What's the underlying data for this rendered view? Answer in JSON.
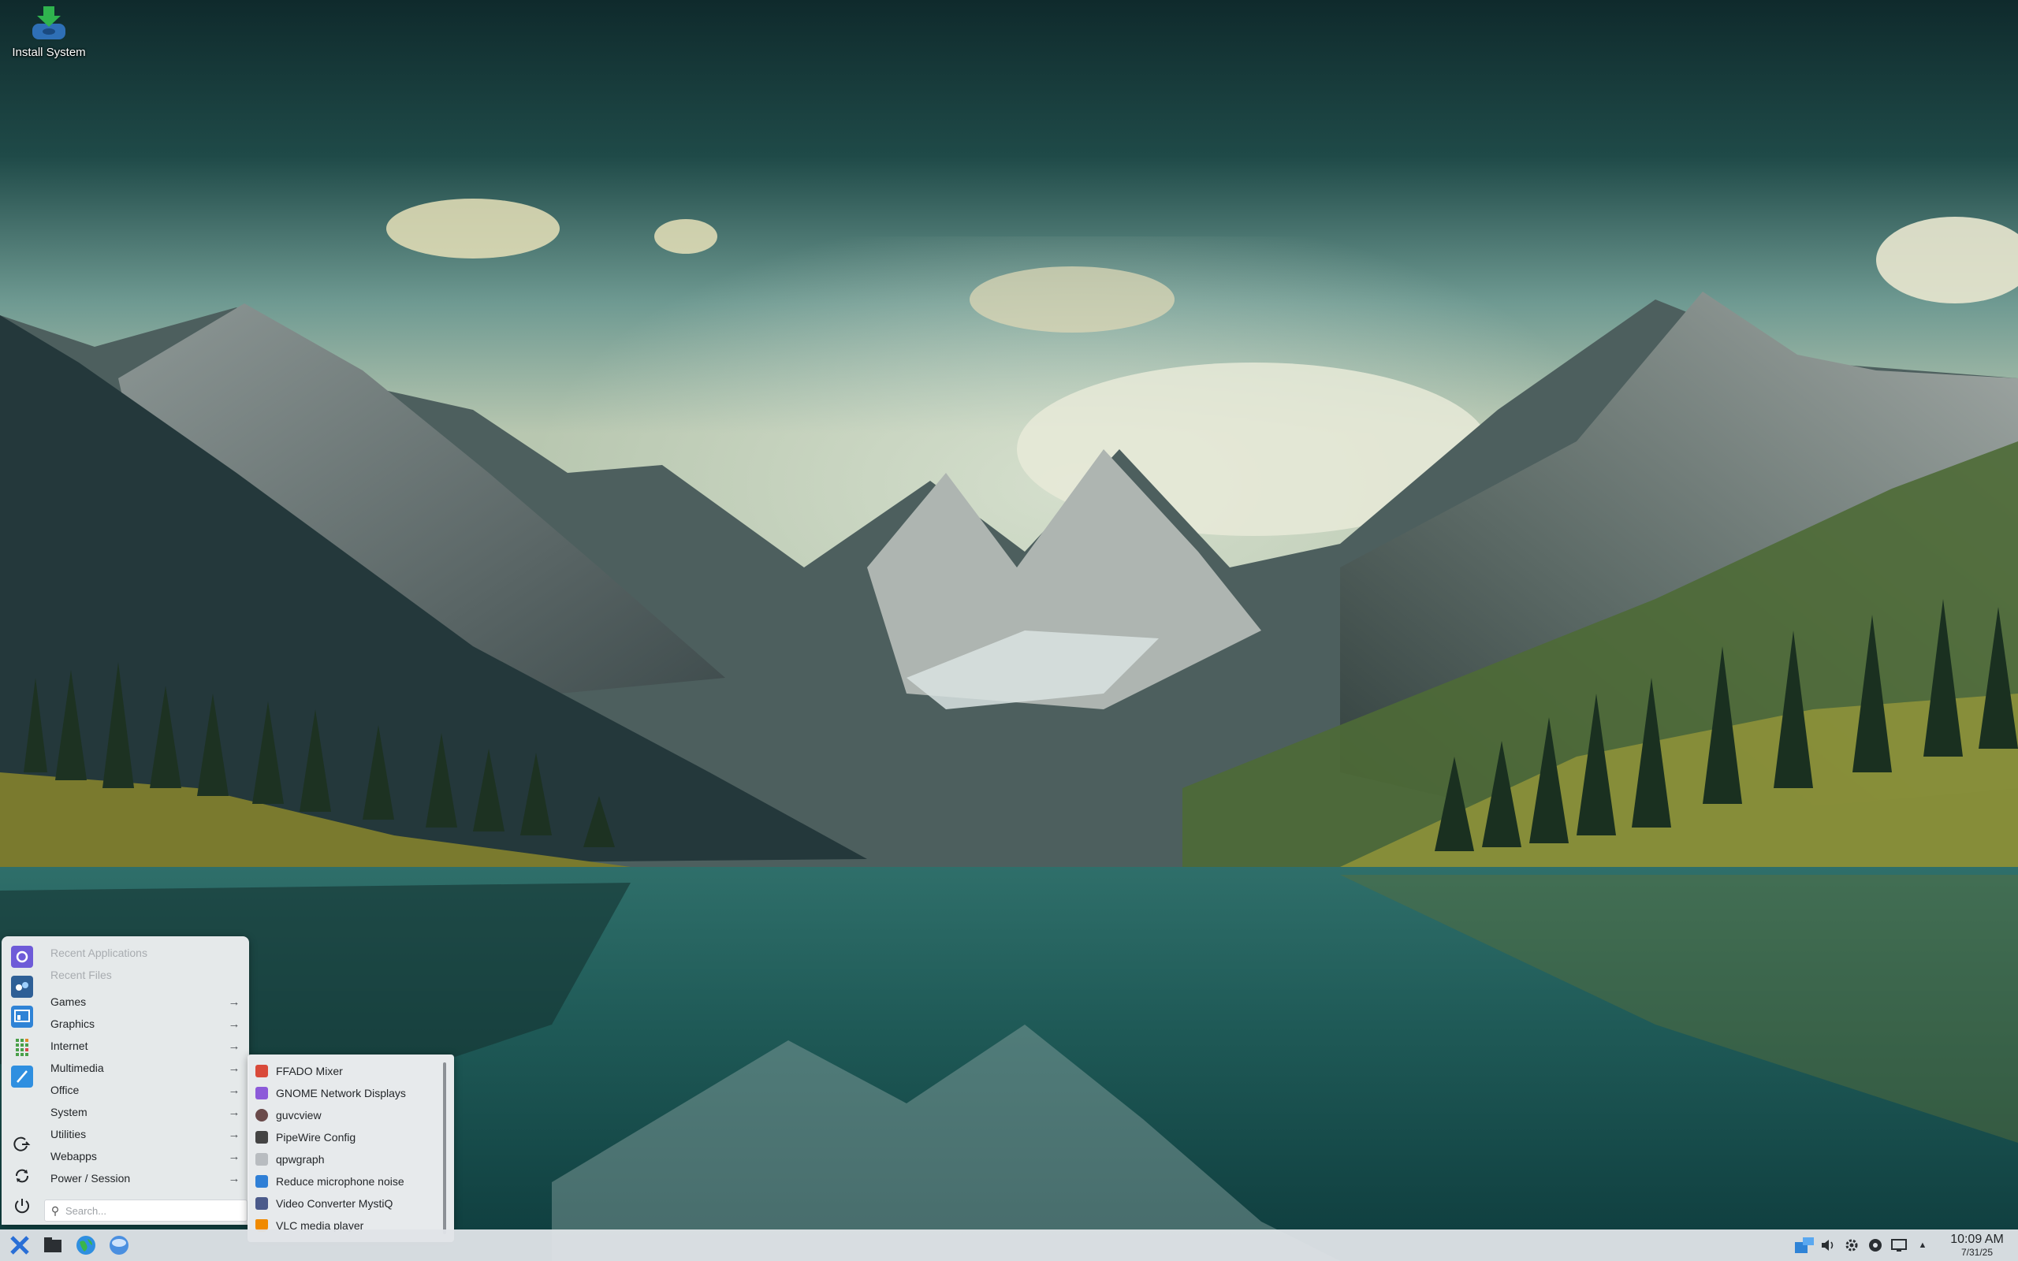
{
  "desktop": {
    "icons": [
      {
        "label": "Install System",
        "icon": "install-system-icon"
      }
    ]
  },
  "menu": {
    "items": [
      {
        "label": "Recent Applications",
        "disabled": true,
        "submenu": false
      },
      {
        "label": "Recent Files",
        "disabled": true,
        "submenu": false
      },
      {
        "label": "Games",
        "submenu": true
      },
      {
        "label": "Graphics",
        "submenu": true
      },
      {
        "label": "Internet",
        "submenu": true
      },
      {
        "label": "Multimedia",
        "submenu": true,
        "active": true
      },
      {
        "label": "Office",
        "submenu": true
      },
      {
        "label": "System",
        "submenu": true
      },
      {
        "label": "Utilities",
        "submenu": true
      },
      {
        "label": "Webapps",
        "submenu": true
      },
      {
        "label": "Power / Session",
        "submenu": true
      }
    ],
    "search_placeholder": "Search...",
    "favorites": [
      {
        "icon": "xfce-settings-icon",
        "color": "#6e5bd8"
      },
      {
        "icon": "software-center-icon",
        "color": "#2e5f96"
      },
      {
        "icon": "system-monitor-icon",
        "color": "#2f83d6"
      },
      {
        "icon": "calculator-icon",
        "color": "#4a9f49"
      },
      {
        "icon": "text-editor-icon",
        "color": "#2f8fe0"
      }
    ],
    "session_buttons": [
      {
        "icon": "logout-icon"
      },
      {
        "icon": "restart-icon"
      },
      {
        "icon": "power-icon"
      }
    ]
  },
  "submenu": {
    "items": [
      {
        "label": "FFADO Mixer",
        "icon": "ffado-mixer-icon",
        "color": "#d94a3a"
      },
      {
        "label": "GNOME Network Displays",
        "icon": "network-displays-icon",
        "color": "#8c5ad9"
      },
      {
        "label": "guvcview",
        "icon": "webcam-icon",
        "color": "#6a4a4a"
      },
      {
        "label": "PipeWire Config",
        "icon": "pipewire-icon",
        "color": "#444444"
      },
      {
        "label": "qpwgraph",
        "icon": "graph-icon",
        "color": "#b8bcc0"
      },
      {
        "label": "Reduce microphone noise",
        "icon": "microphone-noise-icon",
        "color": "#2f7fd6"
      },
      {
        "label": "Video Converter MystiQ",
        "icon": "video-converter-icon",
        "color": "#4b5a8a"
      },
      {
        "label": "VLC media player",
        "icon": "vlc-icon",
        "color": "#f08a00"
      }
    ]
  },
  "taskbar": {
    "launchers": [
      {
        "icon": "app-menu-icon"
      },
      {
        "icon": "files-icon"
      },
      {
        "icon": "web-browser-icon"
      },
      {
        "icon": "disk-icon"
      }
    ],
    "tray": [
      {
        "icon": "workspace-switcher-icon"
      },
      {
        "icon": "volume-icon"
      },
      {
        "icon": "settings-icon"
      },
      {
        "icon": "update-icon"
      },
      {
        "icon": "display-icon"
      },
      {
        "icon": "tray-expand-icon"
      }
    ],
    "clock": {
      "time": "10:09 AM",
      "date": "7/31/25"
    }
  }
}
